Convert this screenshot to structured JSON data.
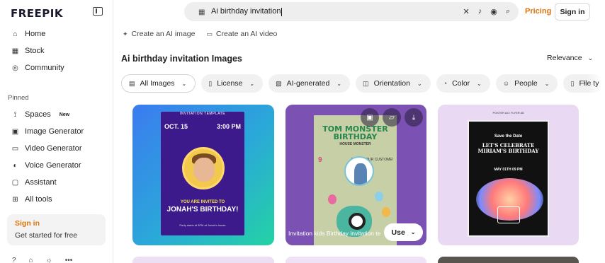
{
  "brand": {
    "logo_text": "FREEPIK"
  },
  "sidebar": {
    "items": [
      {
        "label": "Home",
        "icon": "home-icon"
      },
      {
        "label": "Stock",
        "icon": "grid-icon"
      },
      {
        "label": "Community",
        "icon": "globe-icon"
      }
    ],
    "pinned_label": "Pinned",
    "pinned": [
      {
        "label": "Spaces",
        "icon": "spaces-icon",
        "badge": "New"
      },
      {
        "label": "Image Generator",
        "icon": "image-icon"
      },
      {
        "label": "Video Generator",
        "icon": "video-icon"
      },
      {
        "label": "Voice Generator",
        "icon": "voice-icon"
      },
      {
        "label": "Assistant",
        "icon": "assistant-icon"
      },
      {
        "label": "All tools",
        "icon": "all-tools-icon"
      }
    ],
    "signin_card": {
      "title": "Sign in",
      "subtitle": "Get started for free"
    }
  },
  "search": {
    "query": "Ai birthday invitation"
  },
  "header": {
    "pricing": "Pricing",
    "signin": "Sign in"
  },
  "ai_links": {
    "create_image": "Create an AI image",
    "create_video": "Create an AI video"
  },
  "main": {
    "title": "Ai birthday invitation Images",
    "sort": "Relevance"
  },
  "filters": [
    {
      "label": "All Images",
      "icon": "images-icon"
    },
    {
      "label": "License",
      "icon": "license-icon"
    },
    {
      "label": "AI-generated",
      "icon": "ai-icon"
    },
    {
      "label": "Orientation",
      "icon": "orientation-icon"
    },
    {
      "label": "Color",
      "icon": "palette-icon"
    },
    {
      "label": "People",
      "icon": "people-icon"
    },
    {
      "label": "File ty",
      "icon": "file-icon"
    }
  ],
  "cards": {
    "card1": {
      "tmpl": "INVITATION TEMPLATE",
      "date_l": "OCT. 15",
      "date_r": "3:00 PM",
      "invited": "YOU ARE INVITED TO",
      "name": "JONAH'S BIRTHDAY!",
      "small": "Party starts at 3PM at Jonah's house"
    },
    "card2": {
      "t1": "TOM MONSTER BIRTHDAY",
      "t2": "HOUSE MONSTER",
      "nine": "9",
      "bring": "BRING YOUR CUSTOME!",
      "caption": "Invitation kids   Birthday invitation te",
      "use": "Use"
    },
    "card3": {
      "hdr": "POSTER A4 / FLYER A5",
      "save": "Save the Date",
      "lets": "LET'S CELEBRATE MIRIAM'S BIRTHDAY",
      "may": "MAY 01TH 09 PM"
    }
  },
  "colors": {
    "accent": "#e0730a",
    "card1_top": "#3b7bf0",
    "card1_bottom": "#24d3a4",
    "card2": "#7b52b3",
    "card3": "#ead9f3"
  }
}
